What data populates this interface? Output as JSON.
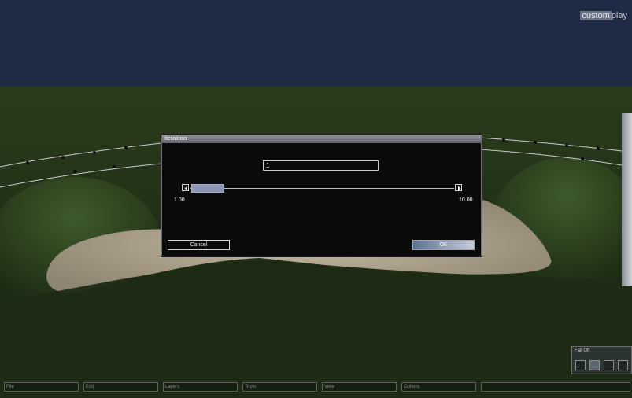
{
  "brand": {
    "part1": "custom",
    "part2": "play"
  },
  "dialog": {
    "title": "Iterations",
    "value": "1",
    "slider": {
      "min_label": "1.00",
      "max_label": "10.00",
      "value": 1
    },
    "cancel_label": "Cancel",
    "ok_label": "OK"
  },
  "falloff": {
    "title": "Fall Off",
    "buttons": [
      "falloff-option-1",
      "falloff-option-2",
      "falloff-option-3",
      "falloff-option-4"
    ],
    "selected_index": 1
  },
  "menubar": {
    "items": [
      "File",
      "Edit",
      "Layers",
      "Tools",
      "View",
      "Options",
      ""
    ]
  },
  "colors": {
    "sky": "#1f2a44",
    "grass": "#23331a",
    "sand": "#b0a692",
    "dialog_bg": "#0b0a0a",
    "slider_thumb": "#8d93b3",
    "ok_button": "#8f9bb5"
  }
}
